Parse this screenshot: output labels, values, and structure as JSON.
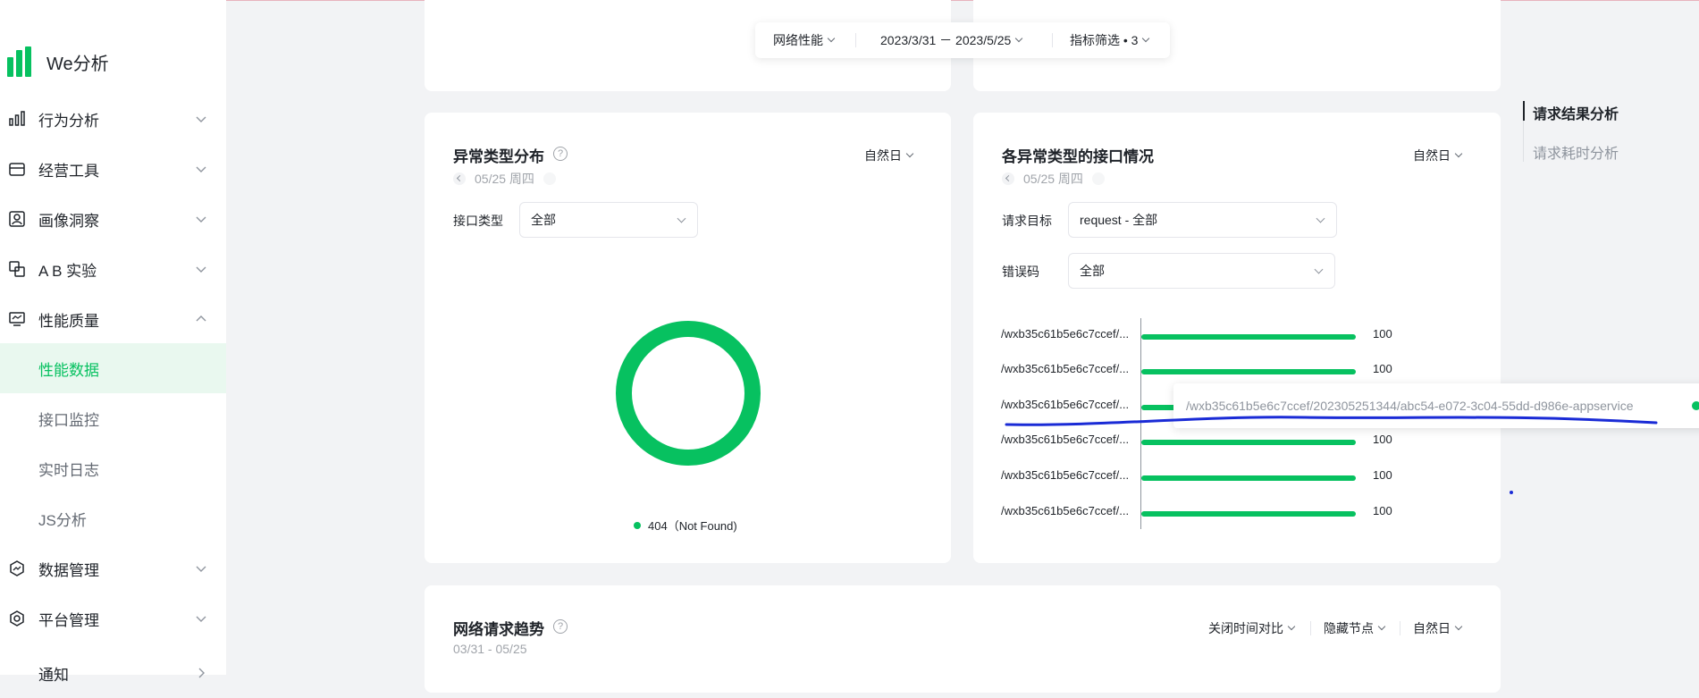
{
  "app": {
    "title": "We分析"
  },
  "sidebar": {
    "items": [
      {
        "label": "行为分析",
        "icon": "bar-chart-icon"
      },
      {
        "label": "经营工具",
        "icon": "store-icon"
      },
      {
        "label": "画像洞察",
        "icon": "user-portrait-icon"
      },
      {
        "label": "A B 实验",
        "icon": "ab-test-icon"
      },
      {
        "label": "性能质量",
        "icon": "monitor-icon",
        "expanded": true
      },
      {
        "label": "数据管理",
        "icon": "data-manage-icon"
      },
      {
        "label": "平台管理",
        "icon": "gear-icon"
      },
      {
        "label": "通知"
      }
    ],
    "sub_items": [
      {
        "label": "性能数据",
        "active": true
      },
      {
        "label": "接口监控"
      },
      {
        "label": "实时日志"
      },
      {
        "label": "JS分析"
      }
    ]
  },
  "filterbar": {
    "network": "网络性能",
    "date_range": "2023/3/31 － 2023/5/25",
    "metric_filter": "指标筛选 • 3"
  },
  "card_left": {
    "title": "异常类型分布",
    "help": "?",
    "date": "05/25 周四",
    "period": "自然日",
    "field_label": "接口类型",
    "field_value": "全部",
    "legend": "404（Not Found)"
  },
  "card_right": {
    "title": "各异常类型的接口情况",
    "date": "05/25 周四",
    "period": "自然日",
    "target_label": "请求目标",
    "target_value": "request - 全部",
    "code_label": "错误码",
    "code_value": "全部",
    "tooltip": "/wxb35c61b5e6c7ccef/202305251344/abc54-e072-3c04-55dd-d986e-appservice"
  },
  "chart_data": {
    "type": "bar",
    "orientation": "horizontal",
    "categories": [
      "/wxb35c61b5e6c7ccef/...",
      "/wxb35c61b5e6c7ccef/...",
      "/wxb35c61b5e6c7ccef/...",
      "/wxb35c61b5e6c7ccef/...",
      "/wxb35c61b5e6c7ccef/...",
      "/wxb35c61b5e6c7ccef/..."
    ],
    "values": [
      100,
      100,
      100,
      100,
      100,
      100
    ],
    "value_labels": [
      "100",
      "100",
      "",
      "100",
      "100",
      "100"
    ],
    "color": "#07c160"
  },
  "donut": {
    "categories": [
      "404（Not Found)"
    ],
    "values": [
      1
    ],
    "color": "#07c160"
  },
  "card_bottom": {
    "title": "网络请求趋势",
    "help": "?",
    "date_range": "03/31 - 05/25",
    "compare": "关闭时间对比",
    "hide_nodes": "隐藏节点",
    "period": "自然日"
  },
  "anchors": [
    {
      "label": "请求结果分析",
      "active": true
    },
    {
      "label": "请求耗时分析",
      "active": false
    }
  ],
  "colors": {
    "accent": "#07c160",
    "annotation": "#1a2bd6"
  }
}
